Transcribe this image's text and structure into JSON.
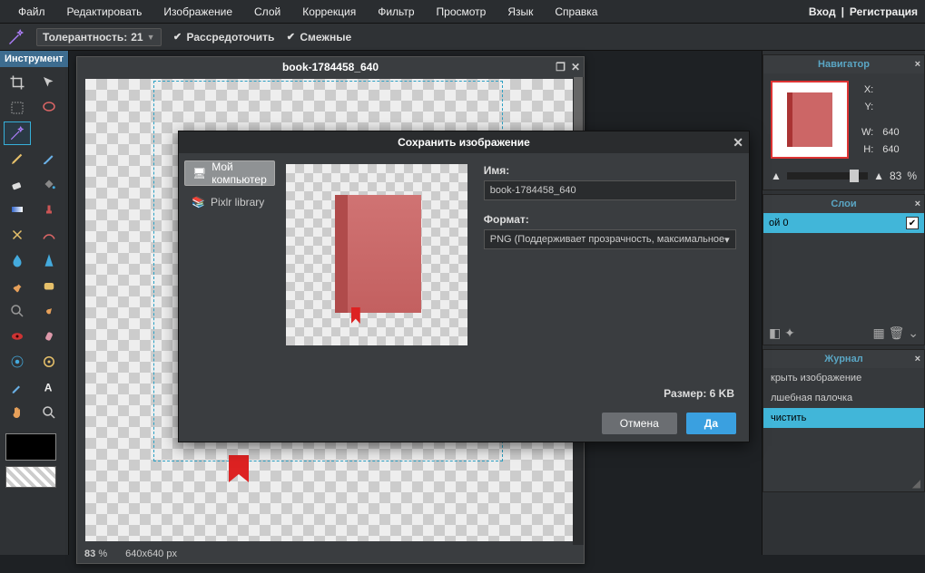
{
  "menubar": {
    "items": [
      "Файл",
      "Редактировать",
      "Изображение",
      "Слой",
      "Коррекция",
      "Фильтр",
      "Просмотр",
      "Язык",
      "Справка"
    ],
    "login": "Вход",
    "sep": "|",
    "register": "Регистрация"
  },
  "optionsbar": {
    "tolerance_label": "Толерантность:",
    "tolerance_value": "21",
    "scatter_label": "Рассредоточить",
    "contiguous_label": "Смежные"
  },
  "toolbox": {
    "header": "Инструмент"
  },
  "document": {
    "title": "book-1784458_640",
    "zoom": "83",
    "zoom_pct": "%",
    "dims": "640x640 px"
  },
  "navigator": {
    "title": "Навигатор",
    "x_label": "X:",
    "y_label": "Y:",
    "w_label": "W:",
    "h_label": "H:",
    "w_val": "640",
    "h_val": "640",
    "zoom": "83",
    "pct": "%"
  },
  "layers": {
    "title": "Слои",
    "layer0": "ой 0"
  },
  "history": {
    "title": "Журнал",
    "item0": "крыть изображение",
    "item1": "лшебная палочка",
    "item2": "чистить"
  },
  "dialog": {
    "title": "Сохранить изображение",
    "tab_my": "Мой компьютер",
    "tab_pixlr": "Pixlr library",
    "name_label": "Имя:",
    "name_value": "book-1784458_640",
    "format_label": "Формат:",
    "format_value": "PNG (Поддерживает прозрачность, максимальное",
    "size_label": "Размер: 6 KB",
    "cancel": "Отмена",
    "ok": "Да"
  }
}
